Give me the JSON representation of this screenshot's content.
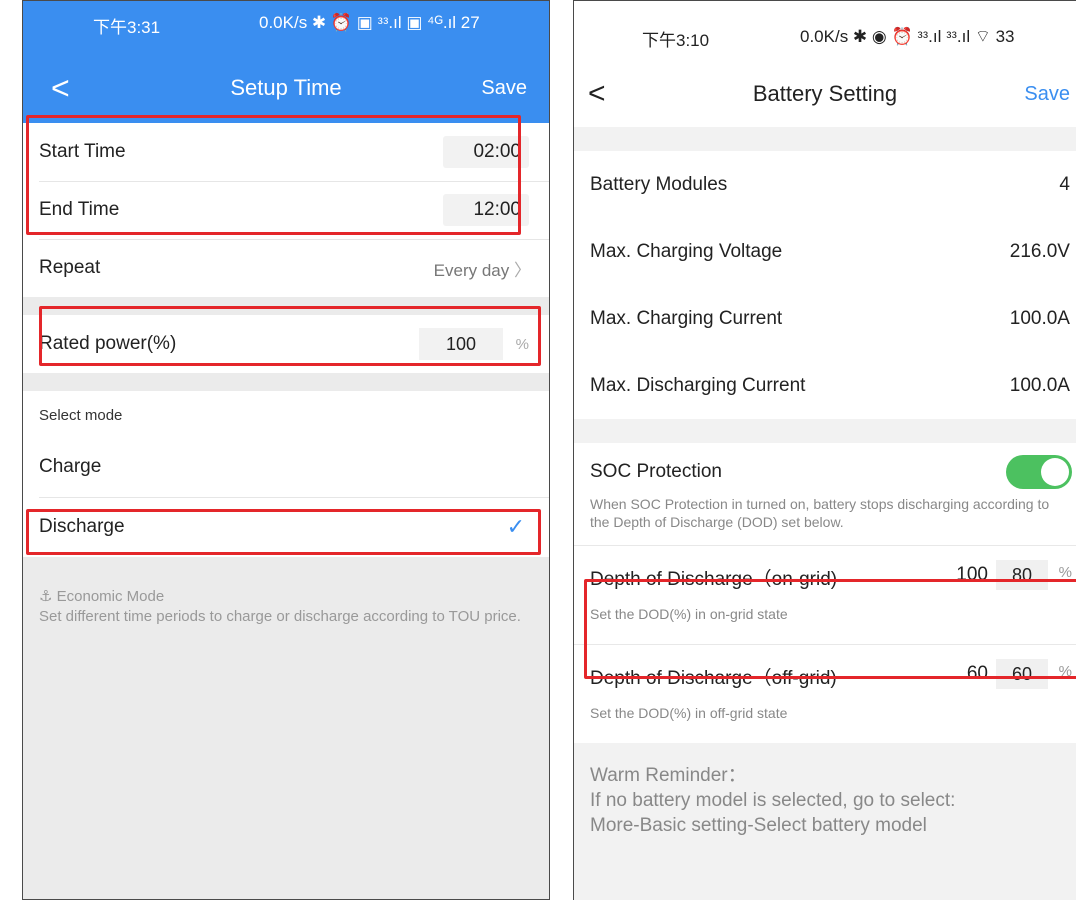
{
  "left": {
    "status": {
      "time": "下午3:31",
      "network": "0.0K/s ✱ ⏰ ▣ ᵌᵌ.ıl ▣ ⁴ᴳ.ıl 27"
    },
    "nav": {
      "back": "<",
      "title": "Setup Time",
      "save": "Save"
    },
    "time_rows": [
      {
        "label": "Start Time",
        "value": "02:00"
      },
      {
        "label": "End Time",
        "value": "12:00"
      }
    ],
    "repeat": {
      "label": "Repeat",
      "value": "Every day",
      "chevron": "〉"
    },
    "rated_power": {
      "label": "Rated power(%)",
      "value": "100",
      "unit": "%"
    },
    "mode": {
      "heading": "Select mode",
      "options": [
        {
          "label": "Charge",
          "selected": false
        },
        {
          "label": "Discharge",
          "selected": true
        }
      ],
      "check": "✓"
    },
    "note": {
      "icon": "economic-mode-icon",
      "title": "Economic Mode",
      "text": "Set different time periods to charge or discharge according to TOU price."
    },
    "colors": {
      "accent": "#3a8ef0",
      "highlight": "#e4262a"
    }
  },
  "right": {
    "status": {
      "time": "下午3:10",
      "network": "0.0K/s ✱ ◉ ⏰ ᵌᵌ.ıl ᵌᵌ.ıl ⌔ 33"
    },
    "nav": {
      "back": "<",
      "title": "Battery Setting",
      "save": "Save"
    },
    "params": [
      {
        "label": "Battery Modules",
        "value": "4"
      },
      {
        "label": "Max. Charging Voltage",
        "value": "216.0V"
      },
      {
        "label": "Max. Charging Current",
        "value": "100.0A"
      },
      {
        "label": "Max. Discharging Current",
        "value": "100.0A"
      }
    ],
    "soc": {
      "label": "SOC Protection",
      "enabled": true,
      "description": "When SOC Protection in turned on,  battery stops discharging according to the Depth of Discharge  (DOD) set below."
    },
    "dod_on_grid": {
      "label": "Depth of Discharge（on-grid)",
      "current": "100",
      "input": "80",
      "unit": "%",
      "hint": "Set the DOD(%) in on-grid state"
    },
    "dod_off_grid": {
      "label": "Depth of Discharge（off-grid)",
      "current": "60",
      "input": "60",
      "unit": "%",
      "hint": "Set the DOD(%) in off-grid state"
    },
    "reminder": {
      "title": "Warm Reminder：",
      "line1": "If no battery model is selected, go to select:",
      "line2": "More-Basic setting-Select battery model"
    },
    "colors": {
      "toggle_on": "#4cc160",
      "accent": "#3a8ef0",
      "highlight": "#e4262a"
    }
  }
}
